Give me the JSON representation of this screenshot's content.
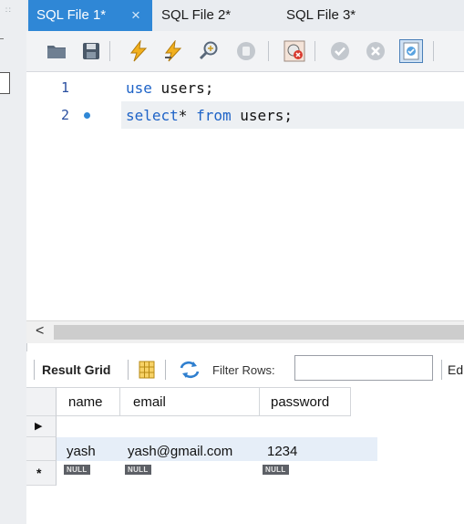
{
  "tabs": [
    {
      "label": "SQL File 1*",
      "active": true
    },
    {
      "label": "SQL File 2*",
      "active": false
    },
    {
      "label": "SQL File 3*",
      "active": false
    }
  ],
  "tab_close_glyph": "×",
  "toolbar_icons": [
    "open-folder-icon",
    "save-icon",
    "execute-lightning-icon",
    "execute-current-icon",
    "explain-magnifier-icon",
    "stop-icon",
    "toggle-stop-on-error-icon",
    "commit-icon",
    "rollback-icon",
    "autocommit-toggle-icon"
  ],
  "editor": {
    "lines": [
      {
        "number": "1",
        "keyword": "use",
        "rest": " users;"
      },
      {
        "number": "2",
        "keyword": "select",
        "rest_a": "* ",
        "keyword2": "from",
        "rest_b": " users;"
      }
    ]
  },
  "scrollbar": {
    "left_arrow": "<"
  },
  "result_toolbar": {
    "result_grid_label": "Result Grid",
    "filter_label": "Filter Rows:",
    "filter_value": "",
    "edit_truncated": "Ed"
  },
  "grid": {
    "columns": [
      "name",
      "email",
      "password"
    ],
    "rows": [
      {
        "name": "yash",
        "email": "yash@gmail.com",
        "password": "1234"
      }
    ],
    "null_label": "NULL",
    "current_row_marker": "▶",
    "new_row_marker": "*"
  },
  "colors": {
    "accent": "#2f87d6",
    "keyword": "#1e63c7",
    "line_number": "#2a4fa0",
    "null_badge": "#5d6066"
  }
}
